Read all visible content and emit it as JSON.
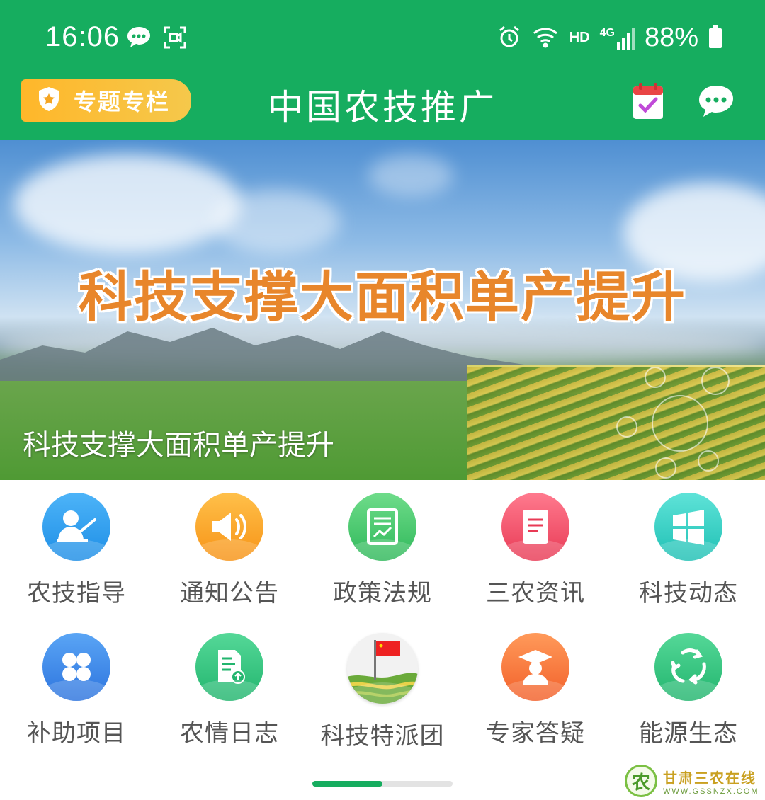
{
  "status_bar": {
    "time": "16:06",
    "network_hd": "HD",
    "network_gen": "4G",
    "battery": "88%"
  },
  "header": {
    "topic_badge": "专题专栏",
    "title": "中国农技推广",
    "calendar_icon": "calendar-check-icon",
    "message_icon": "chat-bubble-icon"
  },
  "banner": {
    "headline": "科技支撑大面积单产提升",
    "caption": "科技支撑大面积单产提升"
  },
  "grid": {
    "items": [
      {
        "label": "农技指导",
        "icon": "teacher-icon",
        "color": "#2f9ef0"
      },
      {
        "label": "通知公告",
        "icon": "speaker-icon",
        "color": "#f9a425"
      },
      {
        "label": "政策法规",
        "icon": "document-chart-icon",
        "color": "#3fc46a"
      },
      {
        "label": "三农资讯",
        "icon": "notepad-icon",
        "color": "#f04a64"
      },
      {
        "label": "科技动态",
        "icon": "windows-icon",
        "color": "#2cc9c0"
      },
      {
        "label": "补助项目",
        "icon": "clover-icon",
        "color": "#3a86e8"
      },
      {
        "label": "农情日志",
        "icon": "document-upload-icon",
        "color": "#2fbf7a"
      },
      {
        "label": "科技特派团",
        "icon": "flag-field-icon",
        "color": "#e9e9e9"
      },
      {
        "label": "专家答疑",
        "icon": "graduate-icon",
        "color": "#f5702d"
      },
      {
        "label": "能源生态",
        "icon": "recycle-icon",
        "color": "#2fbf7a"
      }
    ]
  },
  "pager": {
    "current_page": 1,
    "total_pages": 2
  },
  "watermark": {
    "logo_char": "农",
    "name": "甘肃三农在线",
    "url": "WWW.GSSNZX.COM"
  }
}
